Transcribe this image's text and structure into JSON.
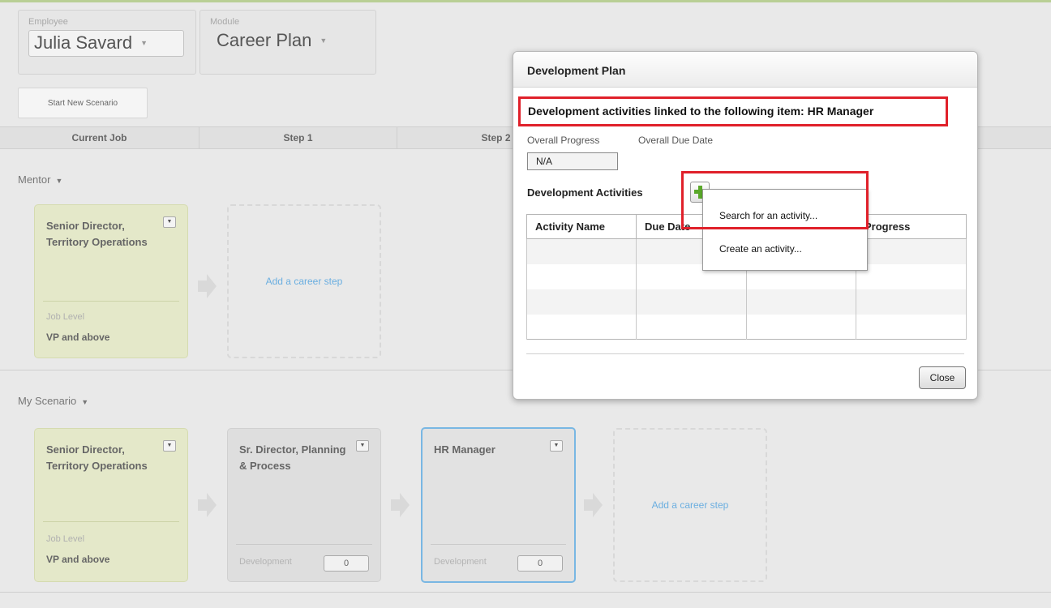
{
  "header": {
    "employee_label": "Employee",
    "employee_value": "Julia Savard",
    "module_label": "Module",
    "module_value": "Career Plan",
    "start_new_scenario": "Start New Scenario"
  },
  "steps_header": [
    "Current Job",
    "Step 1",
    "Step 2"
  ],
  "mentor": {
    "label": "Mentor",
    "current_card": {
      "title": "Senior Director, Territory Operations",
      "job_level_label": "Job Level",
      "job_level_value": "VP and above"
    },
    "add_step": "Add a career step"
  },
  "my_scenario": {
    "label": "My Scenario",
    "current_card": {
      "title": "Senior Director, Territory Operations",
      "job_level_label": "Job Level",
      "job_level_value": "VP and above"
    },
    "step_cards": [
      {
        "title": "Sr. Director, Planning & Process",
        "dev_label": "Development",
        "dev_count": "0"
      },
      {
        "title": "HR Manager",
        "dev_label": "Development",
        "dev_count": "0"
      }
    ],
    "add_step": "Add a career step"
  },
  "dialog": {
    "title": "Development Plan",
    "linked_title": "Development activities linked to the following item: HR Manager",
    "overall_progress_label": "Overall Progress",
    "overall_due_date_label": "Overall Due Date",
    "overall_progress_value": "N/A",
    "dev_activities_label": "Development Activities",
    "columns": [
      "Activity Name",
      "Due Date",
      "",
      "Progress"
    ],
    "close": "Close"
  },
  "add_menu": {
    "search": "Search for an activity...",
    "create": "Create an activity..."
  },
  "colors": {
    "highlight": "#e0202a",
    "link": "#6aaee0",
    "selected_border": "#79b7e3",
    "add_green": "#5aa82a"
  }
}
